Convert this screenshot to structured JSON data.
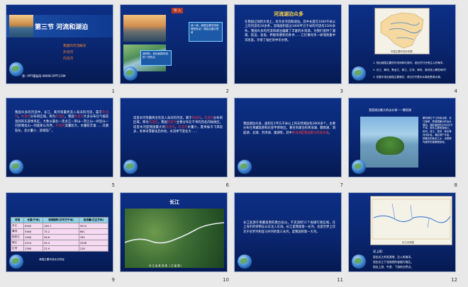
{
  "slides": {
    "s1": {
      "num": "1",
      "title": "第三节 河流和湖泊",
      "menu": [
        "我国的河流概况",
        "外流河",
        "内流河"
      ],
      "footer": "第一PPT模板网-WWW.1PPT.COM"
    },
    "s2": {
      "num": "2",
      "banner": "导 入",
      "caption_left": "我国外流河的特点",
      "callout_top": "读一读，我国主要河流有哪些特点？请结合图片思考",
      "callout_bottom": "读材料，说出我国河流的一些特点"
    },
    "s3": {
      "num": "3",
      "title": "河流湖泊众多",
      "body": "在我国辽阔的大地上，有许多河流和湖泊。其中长度在1000千米以上的河流有20多条，流域面积超过1000平方千米的河流有1500多条。我国众多的河流和湖泊蕴藏了丰富的水资源，为我们提供了灌溉、航运、发电、养殖等便利的条件……它们像母亲一样哺育着中华民族，孕育了灿烂的中华文明。"
    },
    "s4": {
      "num": "4",
      "map_title": "中国主要河流分布图",
      "questions": [
        "1. 找出我国主要的外流河和内流河，说出它们分别注入的海洋。",
        "2. 长江、黄河、黑龙江、珠江、辽河、海河、淮河流入哪些海洋？",
        "3. 在图中找出我国主要湖泊，说出它们是淡水湖还是咸水湖。"
      ]
    },
    "s5": {
      "num": "5",
      "body": "我国众多的河流中，长江、黄河等最终流入海洋的河流，属于外流河。外流河分布的区域，称为外流区。我国外流河大多分布在气候较湿润的东部季风区，大致以最北—黑龙江—阴山—贺兰山—祁连山—巴颜喀拉山—冈底斯山为界。外流河流量较大，水量较丰富……汛期较长，含沙量小、流域较广。",
      "highlights": [
        "外流河",
        "外流区"
      ]
    },
    "s6": {
      "num": "6",
      "body": "塔里木河等最终没有流入海洋的河流，属于内流河。内流河分布的区域，称为内流区。我国内流河主要分布在干旱的西北内陆地区，塔里木河是我国最大的内流河。内流河水量小，夏季候鸟飞来较多，冬季冰雪融化后补给，水流季节变化大……",
      "highlights": [
        "内流河",
        "内流区"
      ]
    },
    "s7": {
      "num": "7",
      "body": "我国湖泊众多，面积在1平方千米以上的天然湖泊有2800多个。主要分布在青藏高原和东部平原地区。著名的湖泊有青海湖、鄱阳湖、洞庭湖、太湖、洪泽湖、巢湖等。其中青海湖是我国最大的咸水湖。",
      "highlight": "青海湖是我国最大的咸水湖"
    },
    "s8": {
      "num": "8",
      "title": "我国湖泊最大的淡水湖——鄱阳湖",
      "side_text": "鄱阳湖位于江西省北部，长江南岸，是我国最大的淡水湖泊。湖区面积约3960平方千米。湖水主要依靠赣江、抚河、信江、饶河、修水等河流补给。湖区物产丰富，是著名的鱼米之乡，也是候鸟越冬的重要栖息地。"
    },
    "s9": {
      "num": "9",
      "table_headers": [
        "河流",
        "长度(千米)",
        "流域面积(万平方千米)",
        "径流量(亿立方米)"
      ],
      "table_rows": [
        [
          "长江",
          "6300",
          "180.7",
          "9513"
        ],
        [
          "黄河",
          "5464",
          "75.2",
          "661"
        ],
        [
          "松花江",
          "1900",
          "56.6",
          "762"
        ],
        [
          "珠江",
          "2214",
          "45.4",
          "3338"
        ],
        [
          "辽河",
          "1390",
          "22.9",
          "126"
        ]
      ],
      "caption": "我国主要河流水文特征"
    },
    "s10": {
      "num": "10",
      "title": "长江",
      "caption": "长 江 及 其 流 域 （ 卫 星 图 ）"
    },
    "s11": {
      "num": "11",
      "body": "长江发源于青藏高原的唐古拉山，干流流经11个省级行政区域，在上海市的崇明岛以东注入东海。长江是我国第一长河，也是世界上仅次于尼罗河和亚马孙河的第三长河，是我国的第一大河。"
    },
    "s12": {
      "num": "12",
      "map_title": "长江水系图",
      "task_title": "读上图：",
      "tasks": [
        "说出长江的发源地、注入的海洋。",
        "找出长江干流流经的省级行政区。",
        "指出上游、中游、下游的分界点。"
      ]
    }
  }
}
